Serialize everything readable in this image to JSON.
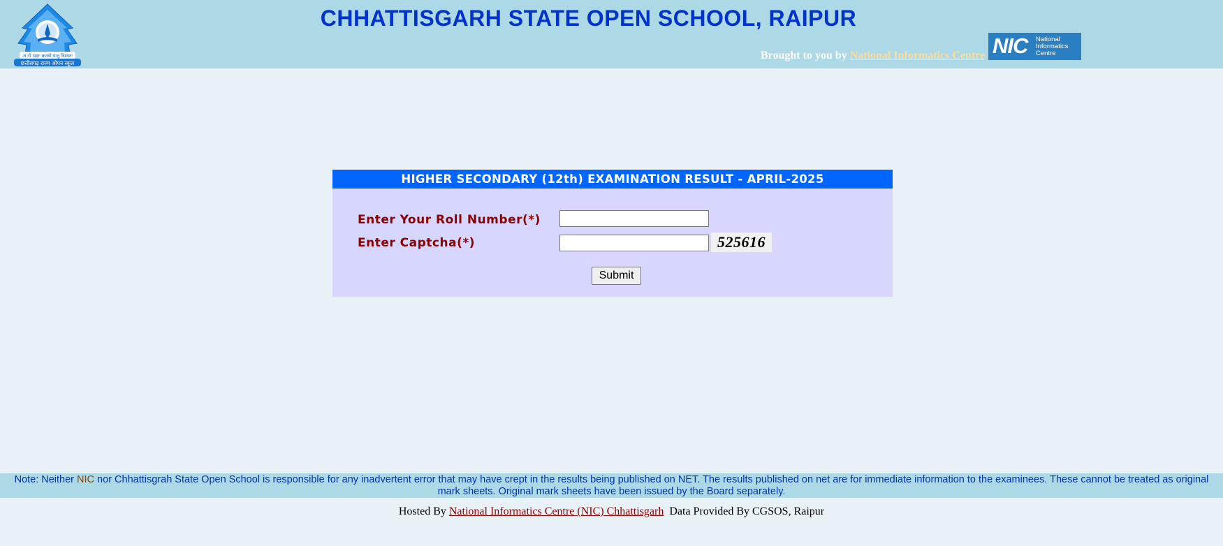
{
  "header": {
    "logo_text": [
      "अ नो भद्राः क्रतवो यन्तु विश्वतः",
      "छत्तीसगढ़ राज्य ओपन स्कूल"
    ],
    "title": "CHHATTISGARH STATE OPEN SCHOOL, RAIPUR",
    "brought_by_prefix": "Brought to you by ",
    "brought_by_link": "National Informatics Centre",
    "nic_logo": {
      "letters": "NIC",
      "text_lines": [
        "National",
        "Informatics",
        "Centre"
      ]
    }
  },
  "form": {
    "heading": "HIGHER SECONDARY (12th) EXAMINATION RESULT - APRIL-2025",
    "roll_label": "Enter Your Roll Number(*)",
    "roll_value": "",
    "captcha_label": "Enter Captcha(*)",
    "captcha_value": "",
    "captcha_code": "525616",
    "submit_label": "Submit"
  },
  "note": {
    "prefix": "Note: Neither ",
    "nic": "NIC",
    "suffix": " nor Chhattisgrah State Open School is responsible for any inadvertent error that may have crept in the results being published on NET. The results published on net are for immediate information to the examinees. These cannot be treated as original mark sheets. Original mark sheets have been issued by the Board separately."
  },
  "footer": {
    "hosted_prefix": "Hosted By ",
    "hosted_link": "National Informatics Centre (NIC) Chhattisgarh",
    "data_provided": "Data Provided By CGSOS, Raipur"
  },
  "colors": {
    "header_bg": "#add8e6",
    "page_bg": "#e8f1f5",
    "title": "#0033cc",
    "form_header_bg": "#0066ff",
    "form_bg": "#d6d6ff",
    "label": "#8b0000"
  }
}
